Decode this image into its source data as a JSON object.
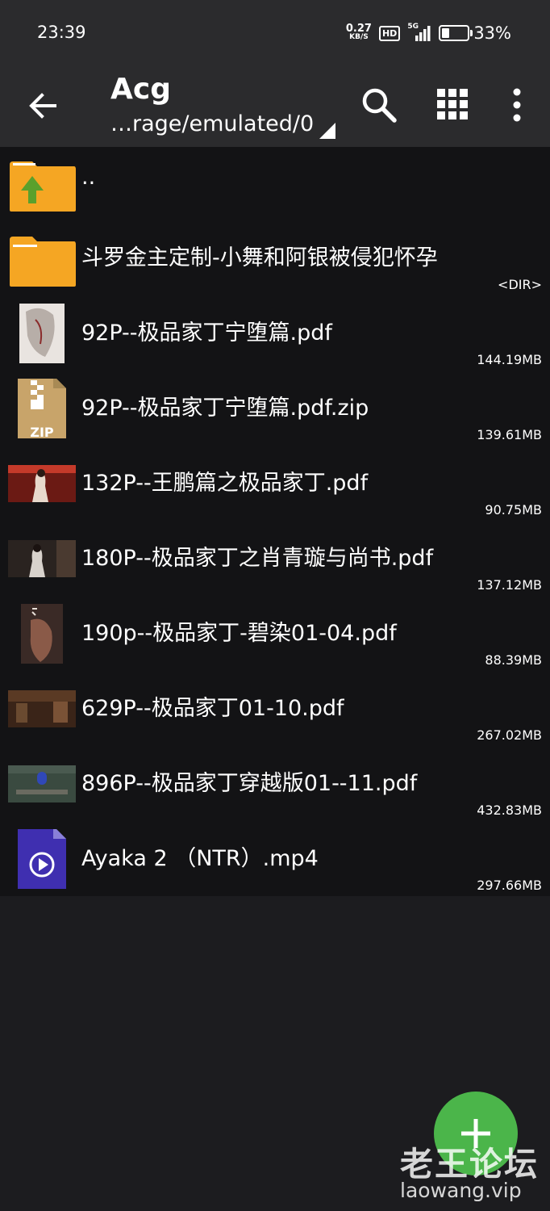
{
  "status_bar": {
    "time": "23:39",
    "net_speed": "0.27",
    "net_unit": "KB/S",
    "hd": "HD",
    "network": "5G",
    "battery_percent": "33%",
    "battery_level": 0.33
  },
  "app_bar": {
    "title": "Acg",
    "path": "…rage/emulated/0"
  },
  "files": [
    {
      "name": "..",
      "meta": "",
      "icon": "folder-up-icon"
    },
    {
      "name": "斗罗金主定制-小舞和阿银被侵犯怀孕",
      "meta": "<DIR>",
      "icon": "folder-icon"
    },
    {
      "name": "92P--极品家丁宁堕篇.pdf",
      "meta": "144.19MB",
      "icon": "pdf-thumbnail"
    },
    {
      "name": "92P--极品家丁宁堕篇.pdf.zip",
      "meta": "139.61MB",
      "icon": "zip-file-icon"
    },
    {
      "name": "132P--王鹏篇之极品家丁.pdf",
      "meta": "90.75MB",
      "icon": "pdf-thumbnail"
    },
    {
      "name": "180P--极品家丁之肖青璇与尚书.pdf",
      "meta": "137.12MB",
      "icon": "pdf-thumbnail"
    },
    {
      "name": "190p--极品家丁-碧染01-04.pdf",
      "meta": "88.39MB",
      "icon": "pdf-thumbnail"
    },
    {
      "name": "629P--极品家丁01-10.pdf",
      "meta": "267.02MB",
      "icon": "pdf-thumbnail"
    },
    {
      "name": "896P--极品家丁穿越版01--11.pdf",
      "meta": "432.83MB",
      "icon": "pdf-thumbnail"
    },
    {
      "name": "Ayaka 2 （NTR）.mp4",
      "meta": "297.66MB",
      "icon": "video-file-icon"
    }
  ],
  "fab": {
    "icon": "plus-icon"
  },
  "watermark": {
    "text": "老王论坛",
    "url": "laowang.vip"
  },
  "colors": {
    "folder": "#f5a623",
    "arrow_up": "#5aa02c",
    "fab": "#4bb54a",
    "video": "#3f2fb0",
    "background": "#131315",
    "toolbar": "#2b2b2d"
  }
}
